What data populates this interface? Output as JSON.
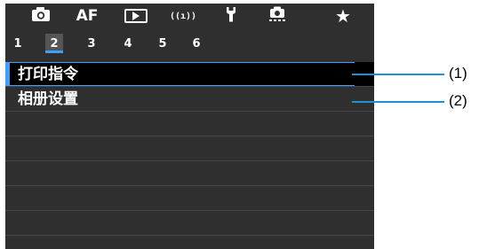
{
  "top_tabs": [
    {
      "id": "shooting",
      "icon": "camera-icon",
      "label": ""
    },
    {
      "id": "af",
      "icon": "",
      "label": "AF"
    },
    {
      "id": "playback",
      "icon": "playback-icon",
      "label": ""
    },
    {
      "id": "wireless",
      "icon": "wireless-icon",
      "label": "((ı))"
    },
    {
      "id": "setup",
      "icon": "wrench-icon",
      "label": ""
    },
    {
      "id": "custom",
      "icon": "custom-functions-icon",
      "label": ""
    },
    {
      "id": "mymenu",
      "icon": "star-icon",
      "label": "★"
    }
  ],
  "top_tabs_active": "playback",
  "sub_tabs": [
    "1",
    "2",
    "3",
    "4",
    "5",
    "6"
  ],
  "sub_tabs_active": "2",
  "menu_items": [
    {
      "label": "打印指令",
      "selected": true
    },
    {
      "label": "相册设置",
      "selected": false
    }
  ],
  "empty_rows": 5,
  "callouts": [
    "(1)",
    "(2)"
  ],
  "colors": {
    "accent": "#3da0ff",
    "screen_bg": "#2f2f2f",
    "callout": "#1e90d6"
  }
}
